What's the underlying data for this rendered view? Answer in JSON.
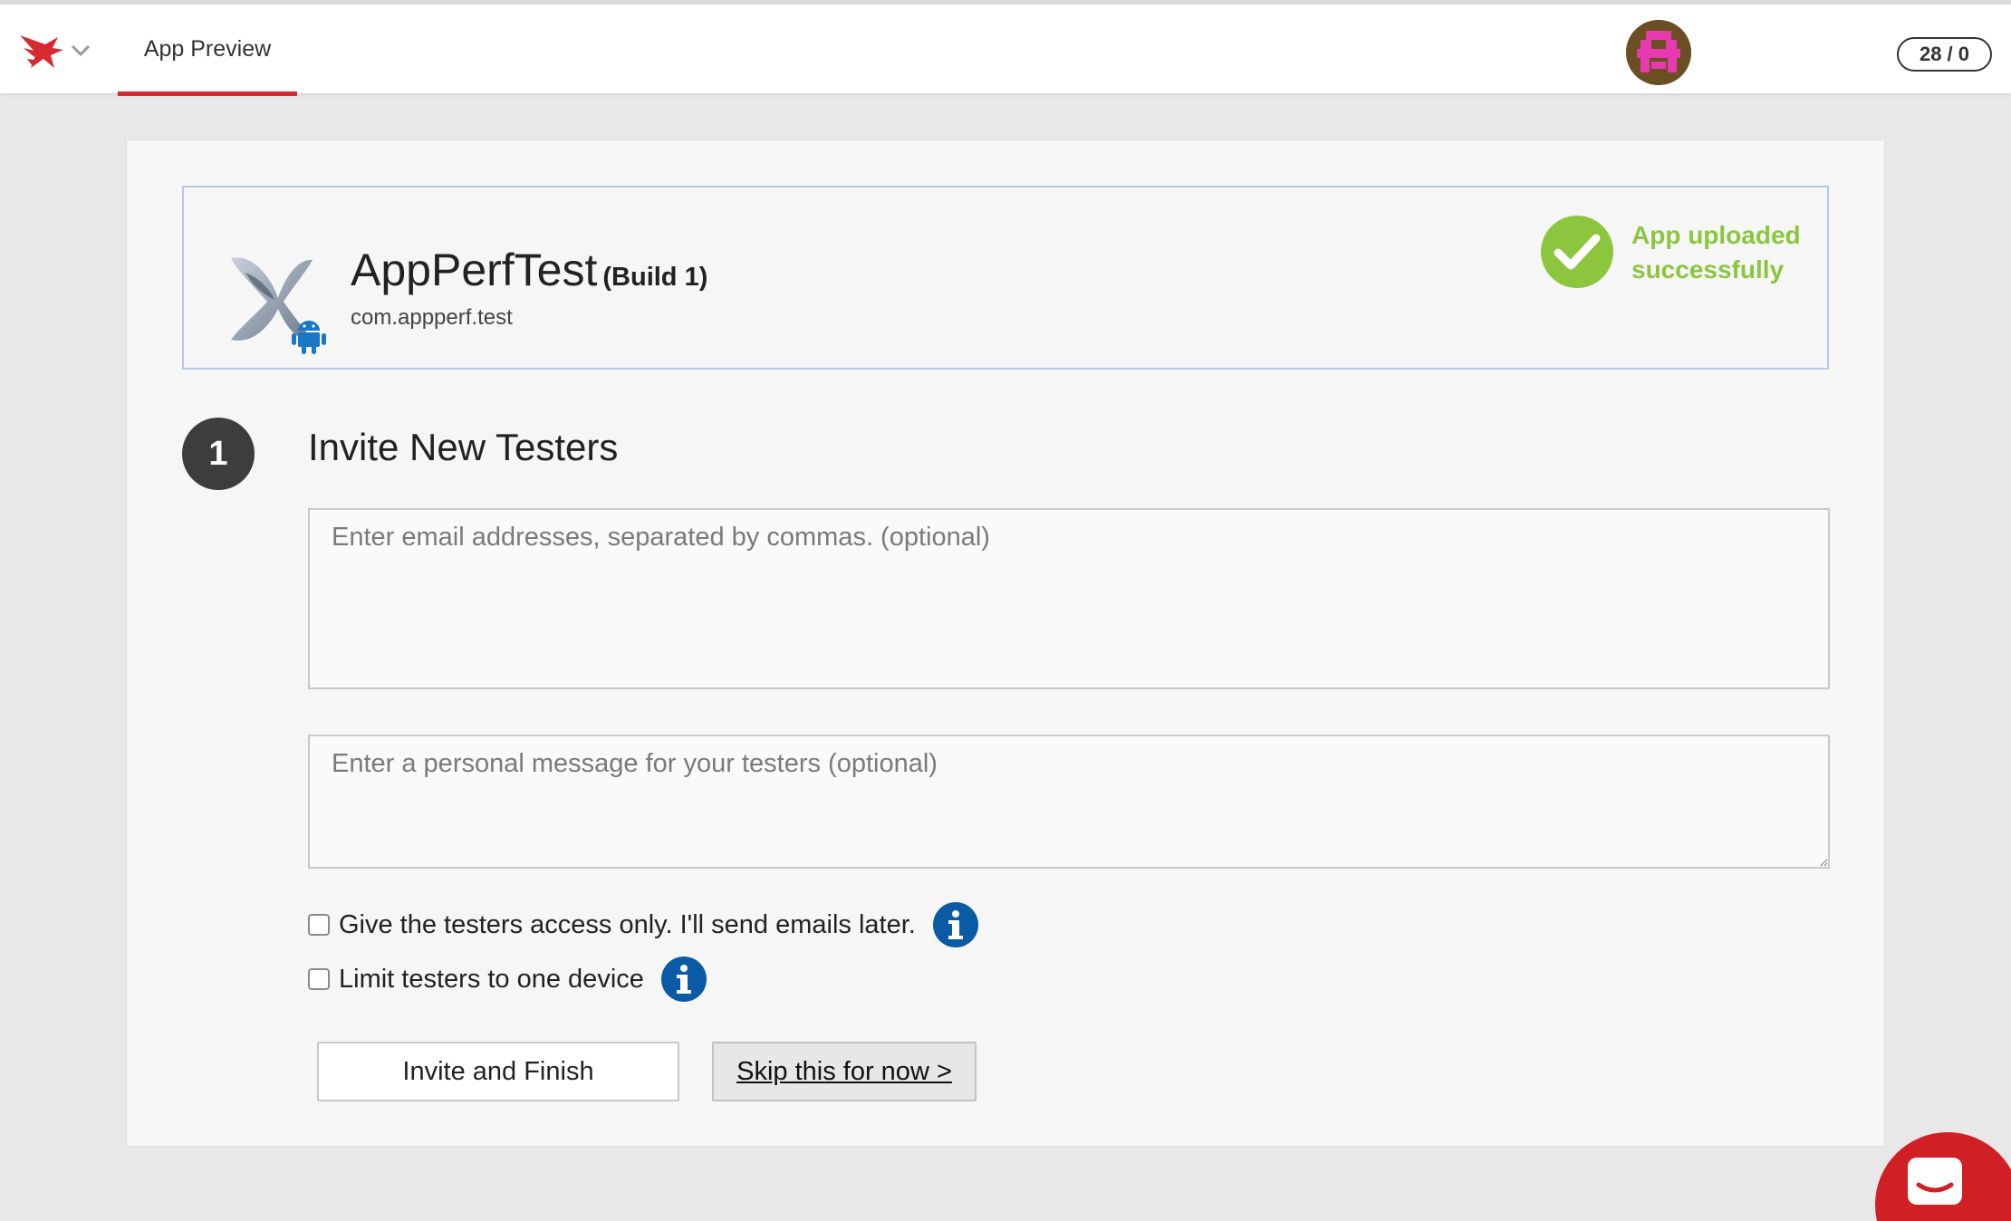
{
  "topbar": {
    "tab_label": "App Preview",
    "counter": "28 / 0"
  },
  "app": {
    "name": "AppPerfTest",
    "build": "(Build 1)",
    "bundle_id": "com.appperf.test",
    "upload_status": "App uploaded successfully"
  },
  "invite": {
    "step_number": "1",
    "title": "Invite New Testers",
    "emails_placeholder": "Enter email addresses, separated by commas. (optional)",
    "message_placeholder": "Enter a personal message for your testers (optional)",
    "access_only_label": "Give the testers access only. I'll send emails later.",
    "limit_device_label": "Limit testers to one device",
    "invite_button": "Invite and Finish",
    "skip_button": "Skip this for now >"
  },
  "colors": {
    "brand_red": "#d72a30",
    "success_green": "#8cc63f",
    "info_blue": "#0b5aa5",
    "step_dark": "#3d3d3f"
  },
  "icons": {
    "logo": "bird-logo-icon",
    "caret": "chevron-down-icon",
    "app": "xamarin-app-icon",
    "platform": "android-icon",
    "success": "check-circle-icon",
    "info": "info-icon",
    "chat": "chat-icon"
  }
}
